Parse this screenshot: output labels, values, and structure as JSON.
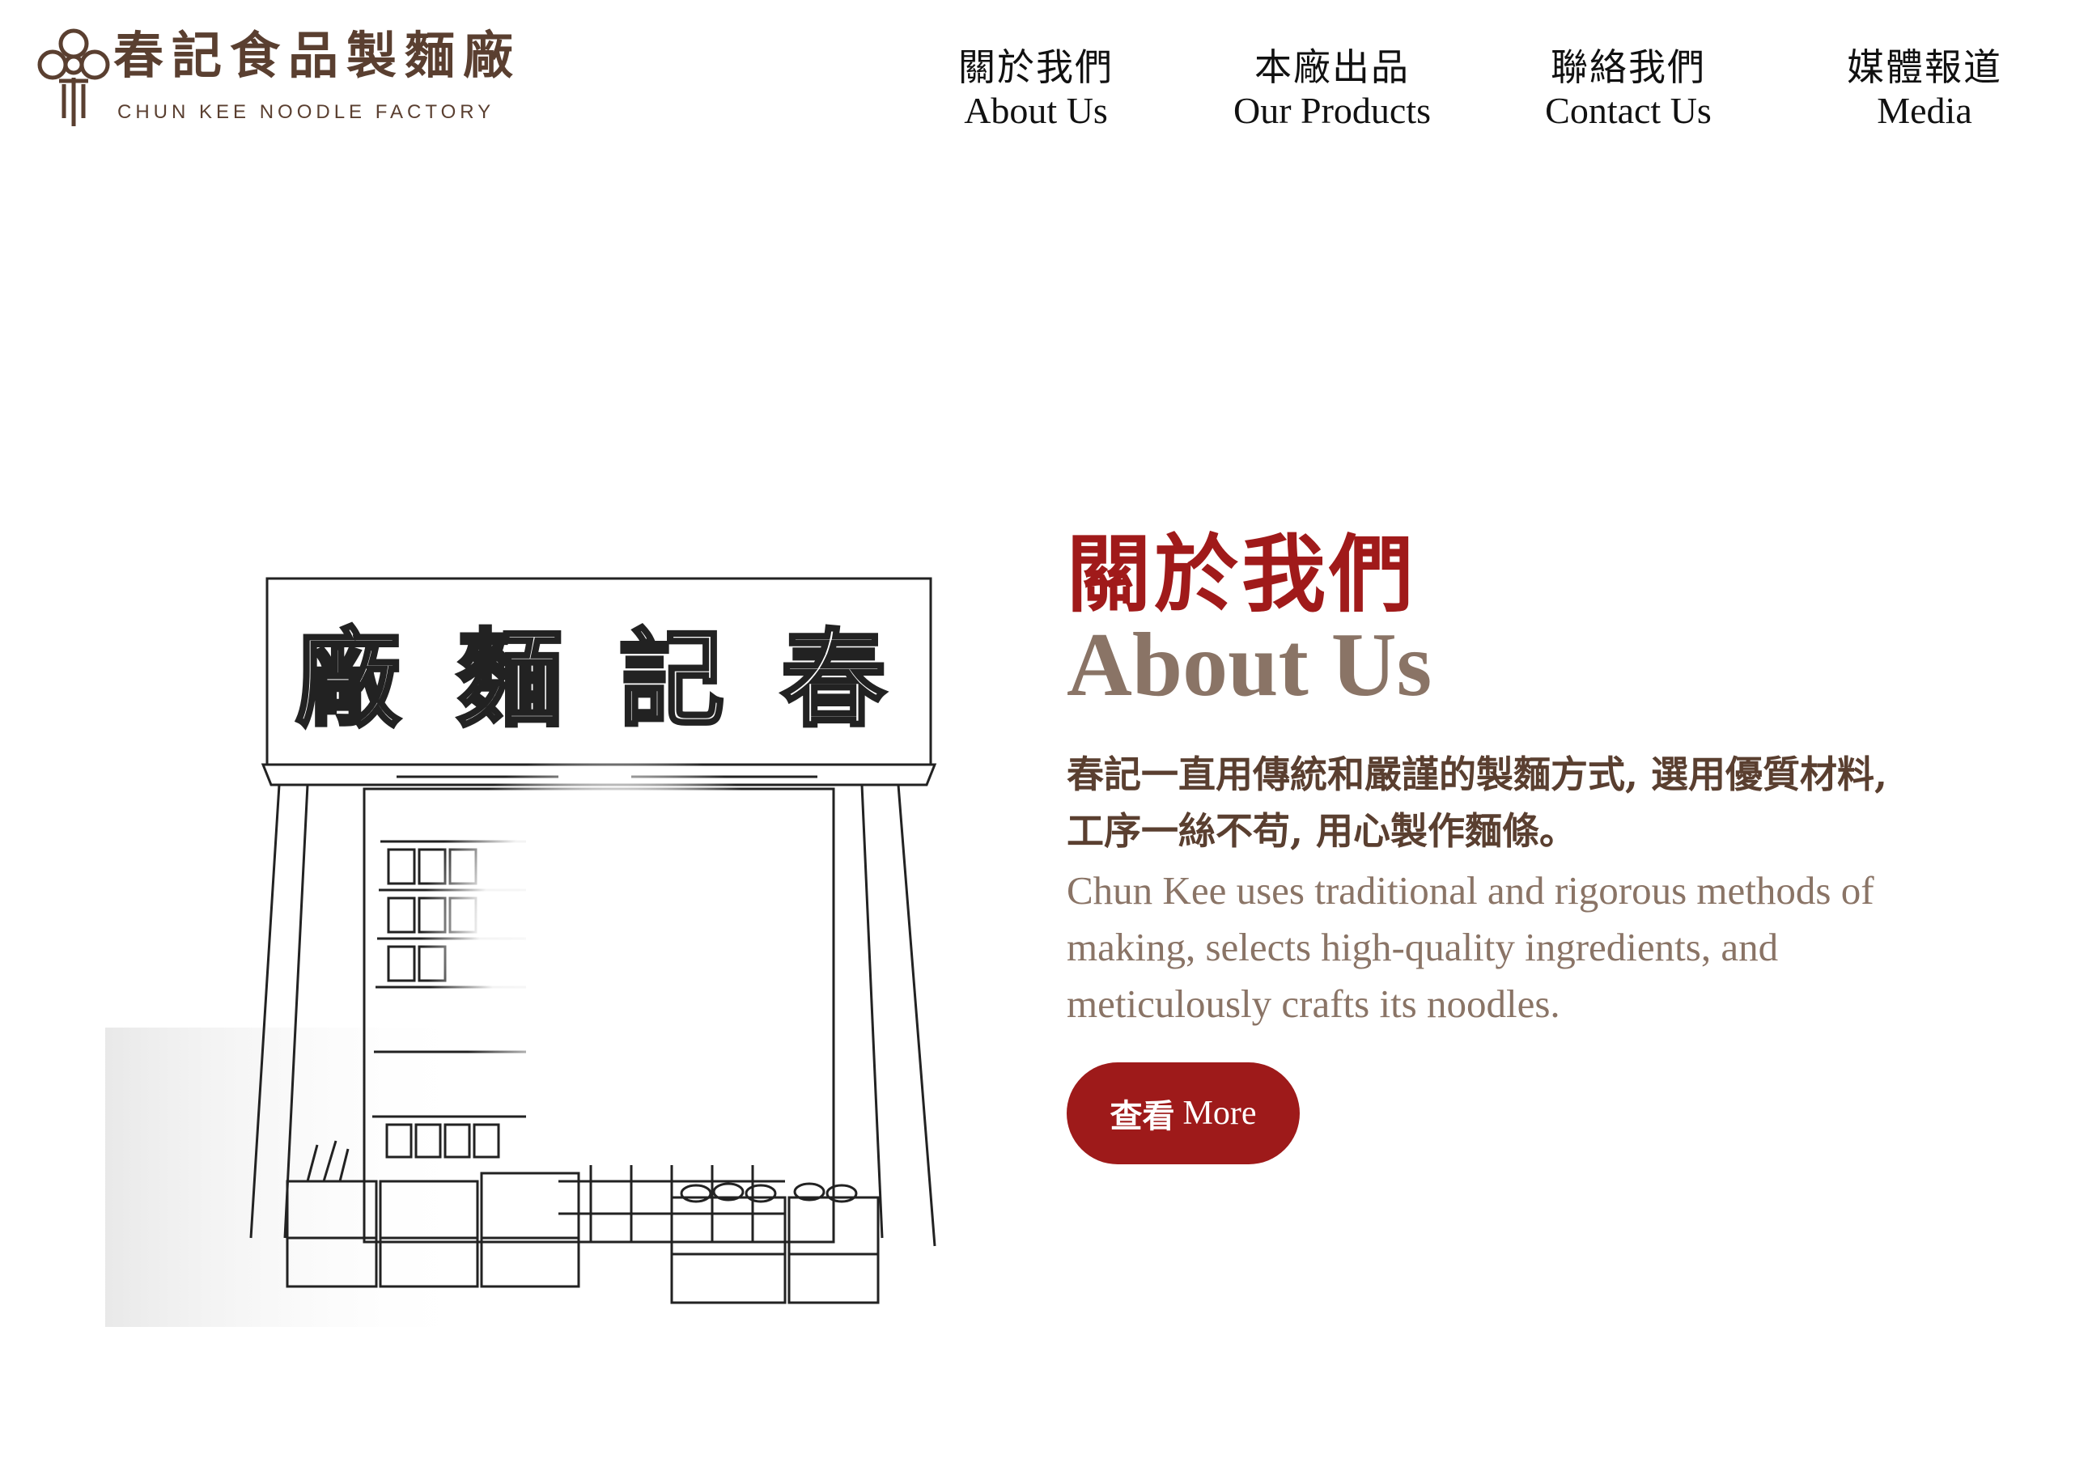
{
  "logo": {
    "name_cn": "春記食品製麵廠",
    "name_en": "CHUN KEE NOODLE FACTORY",
    "icon": "knot-icon"
  },
  "nav": {
    "items": [
      {
        "cn": "關於我們",
        "en": "About Us"
      },
      {
        "cn": "本廠出品",
        "en": "Our Products"
      },
      {
        "cn": "聯絡我們",
        "en": "Contact Us"
      },
      {
        "cn": "媒體報道",
        "en": "Media"
      }
    ]
  },
  "illustration": {
    "sign_text": "廠 麵 記 春"
  },
  "about": {
    "title_cn": "關於我們",
    "title_en": "About Us",
    "desc_cn_line1": "春記一直用傳統和嚴謹的製麵方式, 選用優質材料,",
    "desc_cn_line2": "工序一絲不苟, 用心製作麵條。",
    "desc_en_line1": "Chun Kee uses traditional and rigorous methods of",
    "desc_en_line2": "making, selects high-quality ingredients, and",
    "desc_en_line3": "meticulously crafts its noodles.",
    "button_cn": "查看",
    "button_en": "More"
  },
  "colors": {
    "brand_brown": "#5a3f30",
    "accent_red": "#9e1a1a",
    "muted_brown": "#8a7466"
  }
}
